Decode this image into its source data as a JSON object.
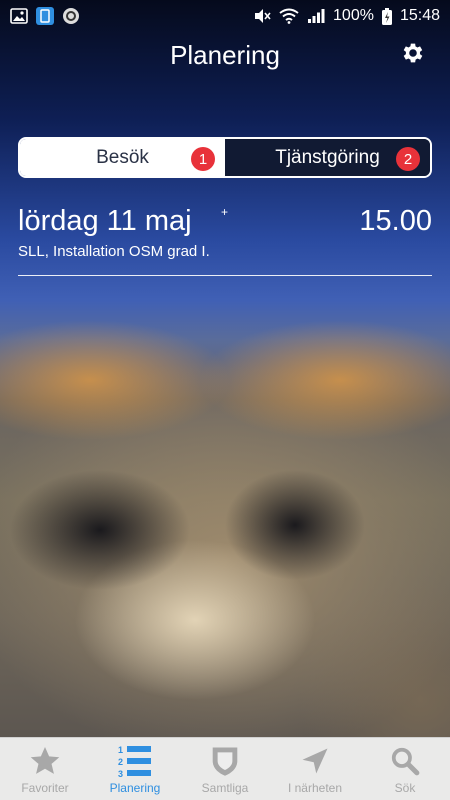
{
  "status_bar": {
    "battery": "100%",
    "time": "15:48",
    "icons": [
      "gallery-icon",
      "phone-screen-icon",
      "circle-app-icon",
      "mute-icon",
      "wifi-icon",
      "signal-icon",
      "battery-icon"
    ]
  },
  "header": {
    "title": "Planering",
    "settings_icon": "gear-icon"
  },
  "segments": [
    {
      "label": "Besök",
      "badge": "1",
      "active": true
    },
    {
      "label": "Tjänstgöring",
      "badge": "2",
      "active": false
    }
  ],
  "event": {
    "date": "lördag 11 maj",
    "marker": "+",
    "time": "15.00",
    "description": "SLL, Installation OSM grad I."
  },
  "tabs": [
    {
      "label": "Favoriter",
      "icon": "star-icon",
      "active": false
    },
    {
      "label": "Planering",
      "icon": "numbered-list-icon",
      "active": true
    },
    {
      "label": "Samtliga",
      "icon": "shield-icon",
      "active": false
    },
    {
      "label": "I närheten",
      "icon": "location-arrow-icon",
      "active": false
    },
    {
      "label": "Sök",
      "icon": "search-icon",
      "active": false
    }
  ],
  "colors": {
    "accent": "#2f8fe0",
    "badge": "#e8323a",
    "tab_inactive": "#a8a8a8",
    "segment_dark": "#111a33"
  }
}
